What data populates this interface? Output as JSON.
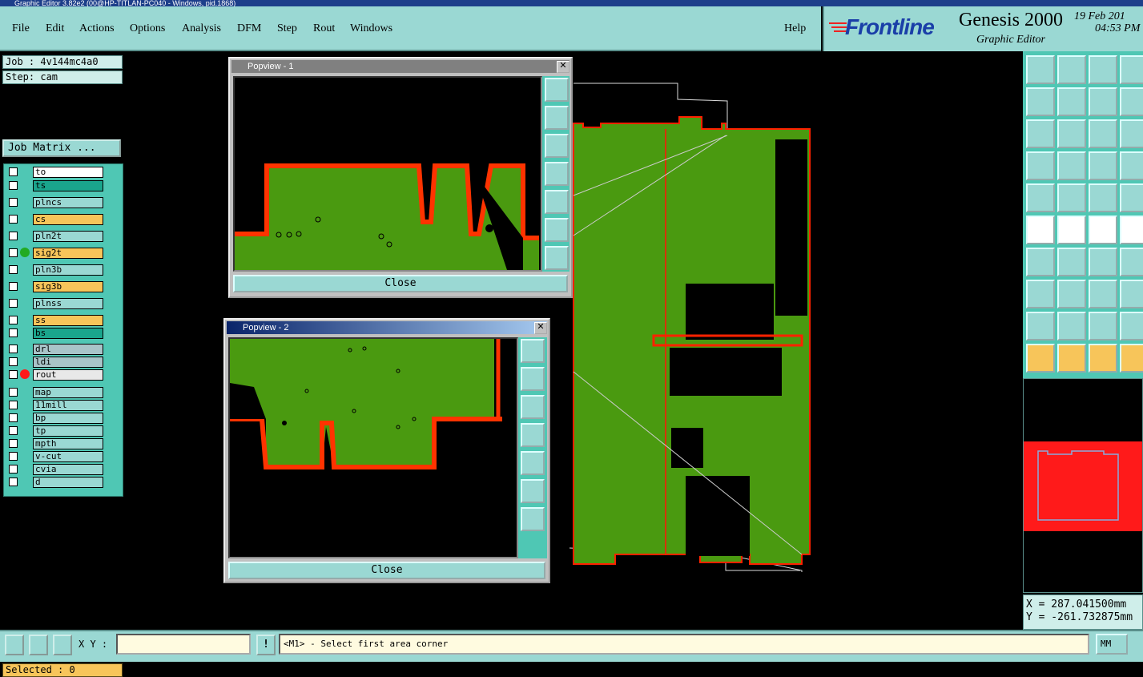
{
  "window": {
    "title": "Graphic Editor 3.82e2 (00@HP-TITLAN-PC040 - Windows, pid.1868)"
  },
  "menu": [
    "File",
    "Edit",
    "Actions",
    "Options",
    "Analysis",
    "DFM",
    "Step",
    "Rout",
    "Windows"
  ],
  "help_label": "Help",
  "brand": {
    "logo": "Frontline",
    "product": "Genesis 2000",
    "subtitle": "Graphic Editor",
    "date": "19 Feb 201",
    "time": "04:53 PM"
  },
  "job": {
    "job_label": "Job : 4v144mc4a0",
    "step_label": "Step: cam",
    "matrix_button": "Job Matrix ..."
  },
  "layers": [
    {
      "name": "to",
      "color": "#ffffff"
    },
    {
      "name": "ts",
      "color": "#1aa58c"
    },
    {
      "name": "plncs",
      "color": "#9ad8d3"
    },
    {
      "name": "cs",
      "color": "#f7c55a"
    },
    {
      "name": "pln2t",
      "color": "#9ad8d3"
    },
    {
      "name": "sig2t",
      "color": "#f7c55a",
      "mark": "#22aa22"
    },
    {
      "name": "pln3b",
      "color": "#9ad8d3"
    },
    {
      "name": "sig3b",
      "color": "#f7c55a"
    },
    {
      "name": "plnss",
      "color": "#9ad8d3"
    },
    {
      "name": "ss",
      "color": "#f7c55a"
    },
    {
      "name": "bs",
      "color": "#1aa58c"
    },
    {
      "name": "drl",
      "color": "#a9c4c8"
    },
    {
      "name": "ldi",
      "color": "#a9c4c8"
    },
    {
      "name": "rout",
      "color": "#e8e8e8",
      "mark": "#ff1a1a"
    },
    {
      "name": "map",
      "color": "#9ad8d3"
    },
    {
      "name": "11mill",
      "color": "#9ad8d3"
    },
    {
      "name": "bp",
      "color": "#9ad8d3"
    },
    {
      "name": "tp",
      "color": "#9ad8d3"
    },
    {
      "name": "mpth",
      "color": "#9ad8d3"
    },
    {
      "name": "v-cut",
      "color": "#9ad8d3"
    },
    {
      "name": "cvia",
      "color": "#9ad8d3"
    },
    {
      "name": "d",
      "color": "#9ad8d3"
    }
  ],
  "selected_label": "Selected : 0",
  "popview1": {
    "title": "Popview - 1",
    "close_label": "Close"
  },
  "popview2": {
    "title": "Popview - 2",
    "close_label": "Close"
  },
  "popview_close_x": "✕",
  "bottom": {
    "xy_label": "X Y :",
    "xy_value": "",
    "prompt": "<M1> - Select first area corner",
    "units": "MM",
    "bang": "!"
  },
  "coords": {
    "x": "X = 287.041500mm",
    "y": "Y = -261.732875mm"
  },
  "colors": {
    "board": "#4a9a10",
    "outline": "#ff2200",
    "panel": "#9ad8d3",
    "tools": "#4fc7b4"
  }
}
